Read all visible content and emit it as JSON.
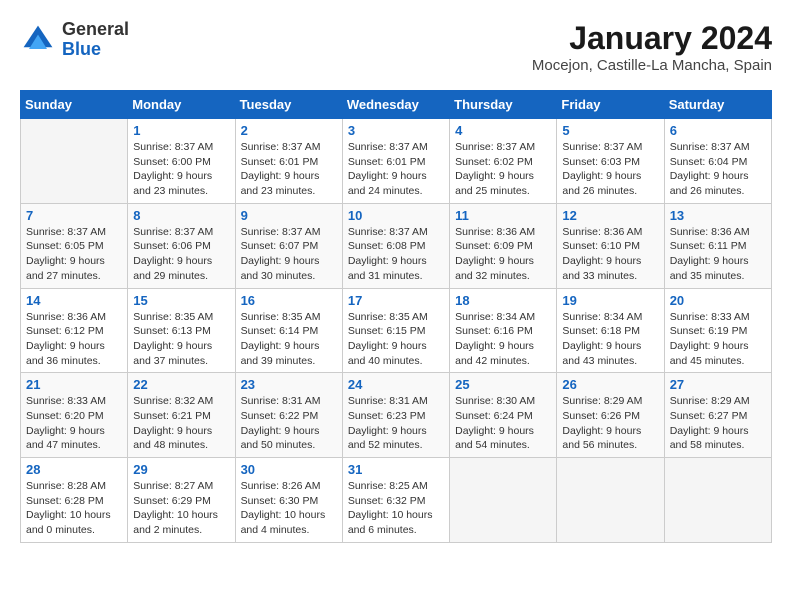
{
  "logo": {
    "general": "General",
    "blue": "Blue"
  },
  "title": "January 2024",
  "location": "Mocejon, Castille-La Mancha, Spain",
  "days_of_week": [
    "Sunday",
    "Monday",
    "Tuesday",
    "Wednesday",
    "Thursday",
    "Friday",
    "Saturday"
  ],
  "weeks": [
    [
      {
        "day": "",
        "info": ""
      },
      {
        "day": "1",
        "info": "Sunrise: 8:37 AM\nSunset: 6:00 PM\nDaylight: 9 hours\nand 23 minutes."
      },
      {
        "day": "2",
        "info": "Sunrise: 8:37 AM\nSunset: 6:01 PM\nDaylight: 9 hours\nand 23 minutes."
      },
      {
        "day": "3",
        "info": "Sunrise: 8:37 AM\nSunset: 6:01 PM\nDaylight: 9 hours\nand 24 minutes."
      },
      {
        "day": "4",
        "info": "Sunrise: 8:37 AM\nSunset: 6:02 PM\nDaylight: 9 hours\nand 25 minutes."
      },
      {
        "day": "5",
        "info": "Sunrise: 8:37 AM\nSunset: 6:03 PM\nDaylight: 9 hours\nand 26 minutes."
      },
      {
        "day": "6",
        "info": "Sunrise: 8:37 AM\nSunset: 6:04 PM\nDaylight: 9 hours\nand 26 minutes."
      }
    ],
    [
      {
        "day": "7",
        "info": "Sunrise: 8:37 AM\nSunset: 6:05 PM\nDaylight: 9 hours\nand 27 minutes."
      },
      {
        "day": "8",
        "info": "Sunrise: 8:37 AM\nSunset: 6:06 PM\nDaylight: 9 hours\nand 29 minutes."
      },
      {
        "day": "9",
        "info": "Sunrise: 8:37 AM\nSunset: 6:07 PM\nDaylight: 9 hours\nand 30 minutes."
      },
      {
        "day": "10",
        "info": "Sunrise: 8:37 AM\nSunset: 6:08 PM\nDaylight: 9 hours\nand 31 minutes."
      },
      {
        "day": "11",
        "info": "Sunrise: 8:36 AM\nSunset: 6:09 PM\nDaylight: 9 hours\nand 32 minutes."
      },
      {
        "day": "12",
        "info": "Sunrise: 8:36 AM\nSunset: 6:10 PM\nDaylight: 9 hours\nand 33 minutes."
      },
      {
        "day": "13",
        "info": "Sunrise: 8:36 AM\nSunset: 6:11 PM\nDaylight: 9 hours\nand 35 minutes."
      }
    ],
    [
      {
        "day": "14",
        "info": "Sunrise: 8:36 AM\nSunset: 6:12 PM\nDaylight: 9 hours\nand 36 minutes."
      },
      {
        "day": "15",
        "info": "Sunrise: 8:35 AM\nSunset: 6:13 PM\nDaylight: 9 hours\nand 37 minutes."
      },
      {
        "day": "16",
        "info": "Sunrise: 8:35 AM\nSunset: 6:14 PM\nDaylight: 9 hours\nand 39 minutes."
      },
      {
        "day": "17",
        "info": "Sunrise: 8:35 AM\nSunset: 6:15 PM\nDaylight: 9 hours\nand 40 minutes."
      },
      {
        "day": "18",
        "info": "Sunrise: 8:34 AM\nSunset: 6:16 PM\nDaylight: 9 hours\nand 42 minutes."
      },
      {
        "day": "19",
        "info": "Sunrise: 8:34 AM\nSunset: 6:18 PM\nDaylight: 9 hours\nand 43 minutes."
      },
      {
        "day": "20",
        "info": "Sunrise: 8:33 AM\nSunset: 6:19 PM\nDaylight: 9 hours\nand 45 minutes."
      }
    ],
    [
      {
        "day": "21",
        "info": "Sunrise: 8:33 AM\nSunset: 6:20 PM\nDaylight: 9 hours\nand 47 minutes."
      },
      {
        "day": "22",
        "info": "Sunrise: 8:32 AM\nSunset: 6:21 PM\nDaylight: 9 hours\nand 48 minutes."
      },
      {
        "day": "23",
        "info": "Sunrise: 8:31 AM\nSunset: 6:22 PM\nDaylight: 9 hours\nand 50 minutes."
      },
      {
        "day": "24",
        "info": "Sunrise: 8:31 AM\nSunset: 6:23 PM\nDaylight: 9 hours\nand 52 minutes."
      },
      {
        "day": "25",
        "info": "Sunrise: 8:30 AM\nSunset: 6:24 PM\nDaylight: 9 hours\nand 54 minutes."
      },
      {
        "day": "26",
        "info": "Sunrise: 8:29 AM\nSunset: 6:26 PM\nDaylight: 9 hours\nand 56 minutes."
      },
      {
        "day": "27",
        "info": "Sunrise: 8:29 AM\nSunset: 6:27 PM\nDaylight: 9 hours\nand 58 minutes."
      }
    ],
    [
      {
        "day": "28",
        "info": "Sunrise: 8:28 AM\nSunset: 6:28 PM\nDaylight: 10 hours\nand 0 minutes."
      },
      {
        "day": "29",
        "info": "Sunrise: 8:27 AM\nSunset: 6:29 PM\nDaylight: 10 hours\nand 2 minutes."
      },
      {
        "day": "30",
        "info": "Sunrise: 8:26 AM\nSunset: 6:30 PM\nDaylight: 10 hours\nand 4 minutes."
      },
      {
        "day": "31",
        "info": "Sunrise: 8:25 AM\nSunset: 6:32 PM\nDaylight: 10 hours\nand 6 minutes."
      },
      {
        "day": "",
        "info": ""
      },
      {
        "day": "",
        "info": ""
      },
      {
        "day": "",
        "info": ""
      }
    ]
  ]
}
